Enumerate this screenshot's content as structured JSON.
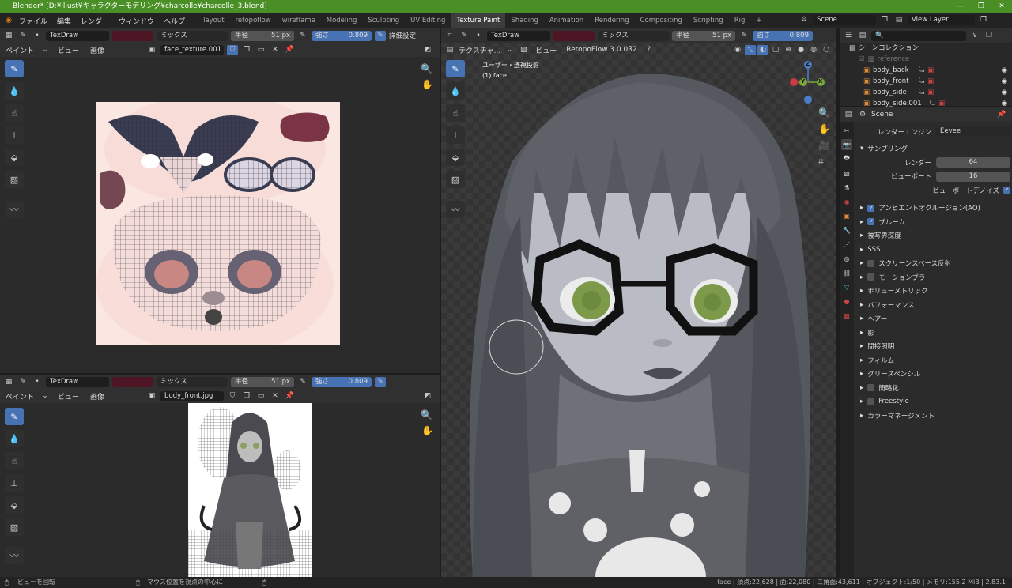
{
  "titlebar": {
    "title": "Blender* [D:¥illust¥キャラクターモデリング¥charcolle¥charcolle_3.blend]",
    "minimize": "—",
    "maximize": "❐",
    "close": "✕"
  },
  "menu": {
    "items": [
      "ファイル",
      "編集",
      "レンダー",
      "ウィンドウ",
      "ヘルプ"
    ]
  },
  "workspaces": {
    "tabs": [
      "layout",
      "retopoflow",
      "wireflame",
      "Modeling",
      "Sculpting",
      "UV Editing",
      "Texture Paint",
      "Shading",
      "Animation",
      "Rendering",
      "Compositing",
      "Scripting",
      "Rig"
    ],
    "active": "Texture Paint",
    "add": "+"
  },
  "scene": {
    "label": "Scene",
    "view_layer": "View Layer"
  },
  "image_editor_top": {
    "brush": "TexDraw",
    "blend": "ミックス",
    "radius_label": "半径",
    "radius": "51 px",
    "strength_label": "強さ",
    "strength": "0.809",
    "detail": "詳細設定",
    "menus": [
      "ペイント",
      "ビュー",
      "画像"
    ],
    "image_name": "face_texture.001"
  },
  "image_editor_bottom": {
    "brush": "TexDraw",
    "blend": "ミックス",
    "radius_label": "半径",
    "radius": "51 px",
    "strength_label": "強さ",
    "strength": "0.809",
    "menus": [
      "ペイント",
      "ビュー",
      "画像"
    ],
    "image_name": "body_front.jpg"
  },
  "viewport": {
    "brush": "TexDraw",
    "blend": "ミックス",
    "radius_label": "半径",
    "radius": "51 px",
    "strength_label": "強さ",
    "strength": "0.809",
    "mode": "テクスチャ...",
    "menu_view": "ビュー",
    "addon": "RetopoFlow 3.0.0β2",
    "overlay_title": "ユーザー・透視投影",
    "overlay_object": "(1) face",
    "gizmo": {
      "x": "X",
      "y": "Y",
      "z": "Z"
    }
  },
  "outliner": {
    "collection": "シーンコレクション",
    "items": [
      {
        "name": "reference"
      },
      {
        "name": "body_back"
      },
      {
        "name": "body_front"
      },
      {
        "name": "body_side"
      },
      {
        "name": "body_side.001"
      }
    ]
  },
  "properties": {
    "scene": "Scene",
    "render_engine_label": "レンダーエンジン",
    "render_engine": "Eevee",
    "sampling": "サンプリング",
    "render_label": "レンダー",
    "render_value": "64",
    "viewport_label": "ビューポート",
    "viewport_value": "16",
    "denoise": "ビューポートデノイズ",
    "sections": [
      {
        "label": "アンビエントオクルージョン(AO)",
        "check": "on"
      },
      {
        "label": "ブルーム",
        "check": "on"
      },
      {
        "label": "被写界深度",
        "check": "none"
      },
      {
        "label": "SSS",
        "check": "none"
      },
      {
        "label": "スクリーンスペース反射",
        "check": "off"
      },
      {
        "label": "モーションブラー",
        "check": "off"
      },
      {
        "label": "ボリューメトリック",
        "check": "none"
      },
      {
        "label": "パフォーマンス",
        "check": "none"
      },
      {
        "label": "ヘアー",
        "check": "none"
      },
      {
        "label": "影",
        "check": "none"
      },
      {
        "label": "間接照明",
        "check": "none"
      },
      {
        "label": "フィルム",
        "check": "none"
      },
      {
        "label": "グリースペンシル",
        "check": "none"
      },
      {
        "label": "簡略化",
        "check": "off"
      },
      {
        "label": "Freestyle",
        "check": "off"
      },
      {
        "label": "カラーマネージメント",
        "check": "none"
      }
    ]
  },
  "statusbar": {
    "left": "ビューを回転",
    "middle": "マウス位置を視点の中心に",
    "stats": "face | 頂点:22,628 | 面:22,080 | 三角面:43,611 | オブジェクト:1/50 | メモリ:155.2 MiB | 2.83.1"
  },
  "colors": {
    "accent": "#4772b3",
    "titlebar": "#4a8f25",
    "brush_color": "#4e1624"
  }
}
